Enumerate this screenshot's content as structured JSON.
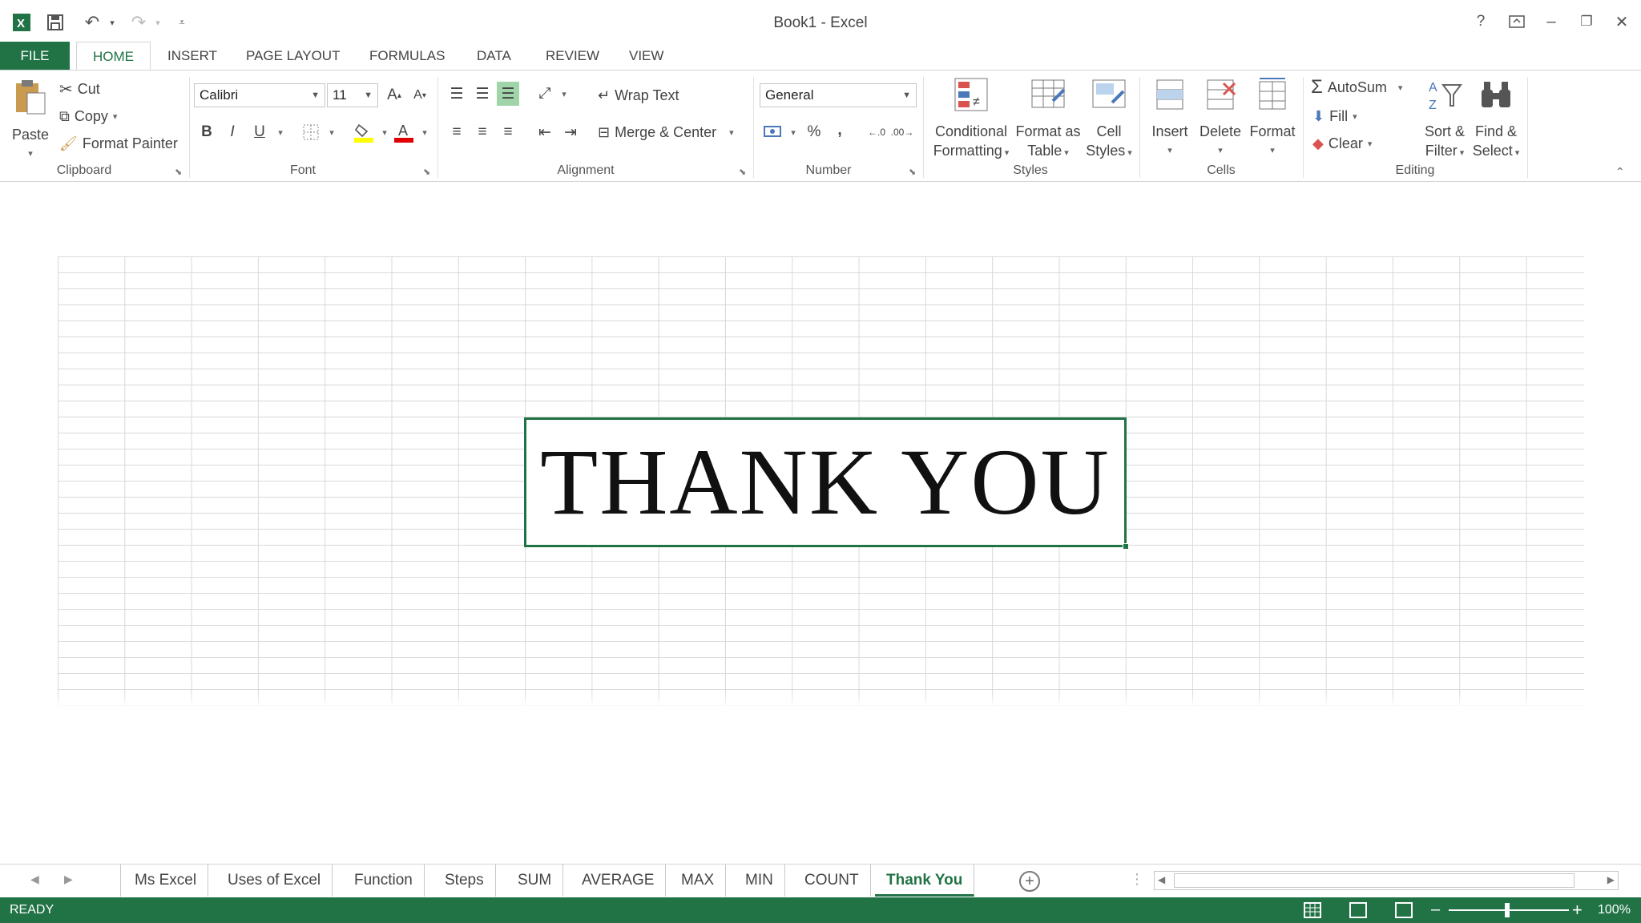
{
  "window": {
    "title": "Book1 - Excel",
    "help": "?",
    "minimize": "–",
    "restore": "❐",
    "close": "✕"
  },
  "tabs": [
    "FILE",
    "HOME",
    "INSERT",
    "PAGE LAYOUT",
    "FORMULAS",
    "DATA",
    "REVIEW",
    "VIEW"
  ],
  "ribbon": {
    "clipboard": {
      "paste": "Paste",
      "cut": "Cut",
      "copy": "Copy",
      "format_painter": "Format Painter",
      "label": "Clipboard"
    },
    "font": {
      "name": "Calibri",
      "size": "11",
      "label": "Font",
      "bold": "B",
      "italic": "I",
      "underline": "U"
    },
    "alignment": {
      "wrap_text": "Wrap Text",
      "merge_center": "Merge & Center",
      "label": "Alignment"
    },
    "number": {
      "format": "General",
      "percent": "%",
      "comma": ",",
      "label": "Number"
    },
    "styles": {
      "conditional": [
        "Conditional",
        "Formatting"
      ],
      "format_table": [
        "Format as",
        "Table"
      ],
      "cell_styles": [
        "Cell",
        "Styles"
      ],
      "label": "Styles"
    },
    "cells": {
      "insert": "Insert",
      "delete": "Delete",
      "format": "Format",
      "label": "Cells"
    },
    "editing": {
      "autosum": "AutoSum",
      "fill": "Fill",
      "clear": "Clear",
      "sort_filter": [
        "Sort &",
        "Filter"
      ],
      "find_select": [
        "Find &",
        "Select"
      ],
      "label": "Editing"
    }
  },
  "cell_content": "THANK YOU",
  "sheets": [
    "Ms Excel",
    "Uses of Excel",
    "Function",
    "Steps",
    "SUM",
    "AVERAGE",
    "MAX",
    "MIN",
    "COUNT",
    "Thank You"
  ],
  "active_sheet": "Thank You",
  "status": {
    "ready": "READY",
    "zoom": "100%"
  },
  "colors": {
    "accent": "#217346"
  }
}
